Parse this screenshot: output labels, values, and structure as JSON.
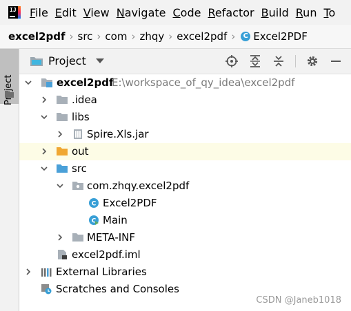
{
  "menu": {
    "items": [
      {
        "mn": "F",
        "rest": "ile"
      },
      {
        "mn": "E",
        "rest": "dit"
      },
      {
        "mn": "V",
        "rest": "iew"
      },
      {
        "mn": "N",
        "rest": "avigate"
      },
      {
        "mn": "C",
        "rest": "ode"
      },
      {
        "mn": "R",
        "rest": "efactor"
      },
      {
        "mn": "B",
        "rest": "uild"
      },
      {
        "mn": "R",
        "rest": "un"
      },
      {
        "mn": "T",
        "rest": "o"
      }
    ]
  },
  "breadcrumb": {
    "items": [
      "excel2pdf",
      "src",
      "com",
      "zhqy",
      "excel2pdf",
      "Excel2PDF"
    ]
  },
  "stripe": {
    "label": "Project"
  },
  "toolwindow": {
    "title": "Project"
  },
  "tree": {
    "rows": [
      {
        "label": "excel2pdf",
        "path": "E:\\workspace_of_qy_idea\\excel2pdf",
        "expanded": true,
        "icon": "module-folder-icon"
      },
      {
        "label": ".idea",
        "expanded": false,
        "icon": "folder-icon"
      },
      {
        "label": "libs",
        "expanded": true,
        "icon": "folder-icon"
      },
      {
        "label": "Spire.Xls.jar",
        "expanded": false,
        "icon": "jar-icon"
      },
      {
        "label": "out",
        "expanded": false,
        "icon": "excluded-folder-icon",
        "highlight": true
      },
      {
        "label": "src",
        "expanded": true,
        "icon": "source-folder-icon"
      },
      {
        "label": "com.zhqy.excel2pdf",
        "expanded": true,
        "icon": "package-icon"
      },
      {
        "label": "Excel2PDF",
        "icon": "class-icon"
      },
      {
        "label": "Main",
        "icon": "class-run-icon"
      },
      {
        "label": "META-INF",
        "expanded": false,
        "icon": "folder-icon"
      },
      {
        "label": "excel2pdf.iml",
        "icon": "iml-file-icon"
      },
      {
        "label": "External Libraries",
        "expanded": false,
        "icon": "library-icon"
      },
      {
        "label": "Scratches and Consoles",
        "icon": "scratches-icon"
      }
    ]
  },
  "watermark": "CSDN @Janeb1018",
  "colors": {
    "folder": "#a8b0b8",
    "excluded": "#f0a732",
    "source": "#4aa0d8",
    "class": "#389fd6",
    "highlight": "#fdfce6"
  }
}
